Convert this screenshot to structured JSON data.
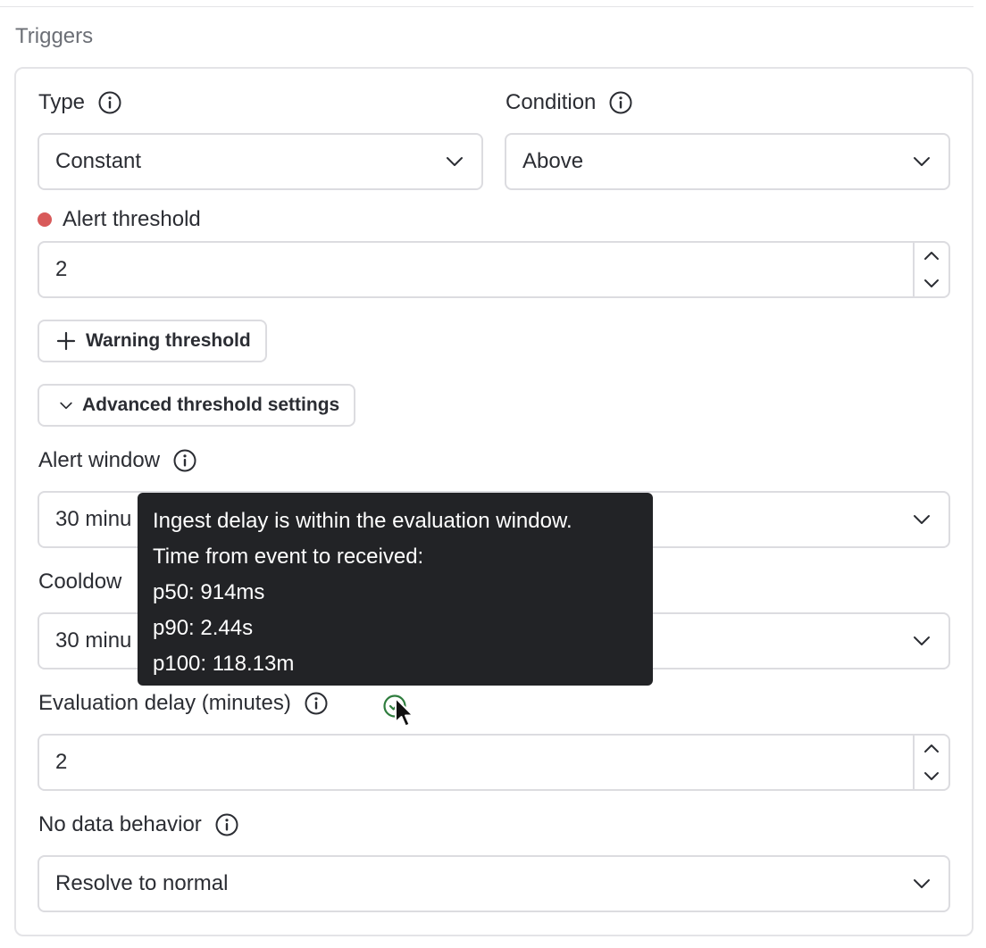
{
  "section": {
    "title": "Triggers"
  },
  "type": {
    "label": "Type",
    "value": "Constant"
  },
  "condition": {
    "label": "Condition",
    "value": "Above"
  },
  "alert_threshold": {
    "label": "Alert threshold",
    "value": "2",
    "indicator_color": "#d85a5a"
  },
  "warning_button": {
    "label": "Warning threshold"
  },
  "advanced_button": {
    "label": "Advanced threshold settings"
  },
  "alert_window": {
    "label": "Alert window",
    "value": "30 minu"
  },
  "cooldown": {
    "label": "Cooldow",
    "value": "30 minu"
  },
  "evaluation_delay": {
    "label": "Evaluation delay (minutes)",
    "value": "2",
    "status_color": "#2f7d3e"
  },
  "no_data": {
    "label": "No data behavior",
    "value": "Resolve to normal"
  },
  "tooltip": {
    "lines": [
      "Ingest delay is within the evaluation window.",
      "Time from event to received:",
      "p50: 914ms",
      "p90: 2.44s",
      "p100: 118.13m"
    ]
  },
  "icons": {
    "info": "info-icon",
    "chevron": "chevron-down-icon",
    "plus": "plus-icon",
    "status": "check-circle-icon",
    "cursor": "mouse-pointer-icon"
  }
}
